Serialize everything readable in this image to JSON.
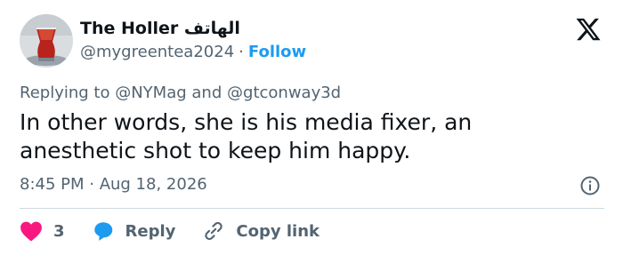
{
  "author": {
    "name": "The Holler الهاتف",
    "handle": "@mygreentea2024",
    "separator": "·",
    "follow_label": "Follow",
    "avatar_icon": "tea-glass-avatar"
  },
  "platform_icon": "x-logo-icon",
  "replying": {
    "prefix": "Replying to",
    "first": "@NYMag",
    "conjunction": "and",
    "second": "@gtconway3d"
  },
  "tweet": {
    "text": "In other words, she is his media fixer, an anesthetic shot to keep him happy."
  },
  "timestamp": "8:45 PM · Aug 18, 2026",
  "actions": {
    "like_count": "3",
    "reply_label": "Reply",
    "copy_label": "Copy link"
  },
  "colors": {
    "accent": "#1d9bf0",
    "like": "#f91880",
    "muted": "#536471",
    "text": "#0f1419"
  }
}
